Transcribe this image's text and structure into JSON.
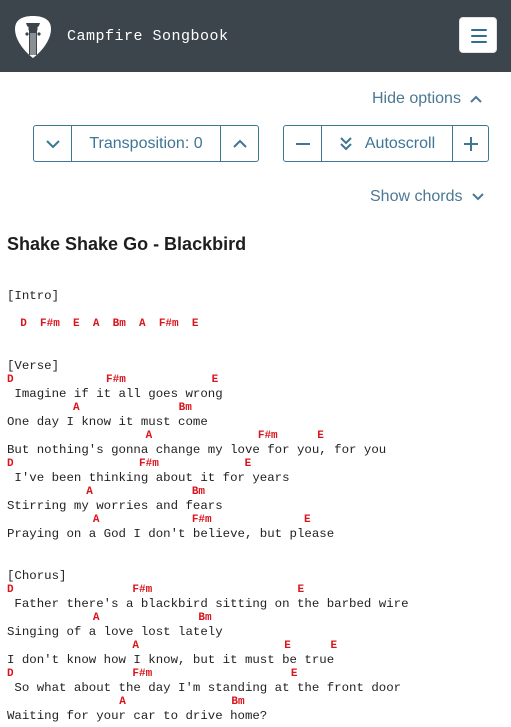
{
  "app": {
    "title": "Campfire Songbook"
  },
  "options": {
    "hide_options": "Hide options",
    "transposition_label": "Transposition: 0",
    "autoscroll_label": "Autoscroll",
    "show_chords": "Show chords"
  },
  "song": {
    "title": "Shake Shake Go - Blackbird",
    "lines": [
      "[Intro]",
      "",
      "  D  F#m  E  A  Bm  A  F#m  E",
      "",
      "",
      "[Verse]",
      "D              F#m             E",
      " Imagine if it all goes wrong",
      "          A               Bm",
      "One day I know it must come",
      "                     A                F#m      E",
      "But nothing's gonna change my love for you, for you",
      "D                   F#m             E",
      " I've been thinking about it for years",
      "            A               Bm",
      "Stirring my worries and fears",
      "             A              F#m              E",
      "Praying on a God I don't believe, but please",
      "",
      "",
      "[Chorus]",
      "D                  F#m                      E",
      " Father there's a blackbird sitting on the barbed wire",
      "             A               Bm",
      "Singing of a love lost lately",
      "                   A                      E      E",
      "I don't know how I know, but it must be true",
      "D                  F#m                     E",
      " So what about the day I'm standing at the front door",
      "                 A                Bm",
      "Waiting for your car to drive home?"
    ]
  }
}
